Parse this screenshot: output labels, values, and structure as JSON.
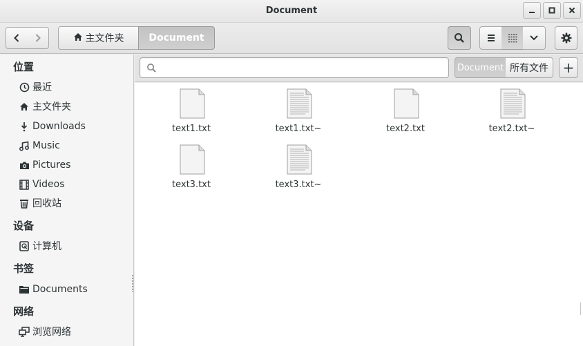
{
  "window": {
    "title": "Document"
  },
  "toolbar": {
    "path_home": "主文件夹",
    "path_current": "Document"
  },
  "sidebar": {
    "places_title": "位置",
    "places": [
      {
        "label": "最近",
        "icon": "clock-icon"
      },
      {
        "label": "主文件夹",
        "icon": "home-icon"
      },
      {
        "label": "Downloads",
        "icon": "download-icon"
      },
      {
        "label": "Music",
        "icon": "music-icon"
      },
      {
        "label": "Pictures",
        "icon": "camera-icon"
      },
      {
        "label": "Videos",
        "icon": "film-icon"
      },
      {
        "label": "回收站",
        "icon": "trash-icon"
      }
    ],
    "devices_title": "设备",
    "devices": [
      {
        "label": "计算机",
        "icon": "drive-icon"
      }
    ],
    "bookmarks_title": "书签",
    "bookmarks": [
      {
        "label": "Documents",
        "icon": "folder-icon"
      }
    ],
    "network_title": "网络",
    "network": [
      {
        "label": "浏览网络",
        "icon": "network-icon"
      }
    ]
  },
  "search": {
    "placeholder": "",
    "scope_current": "Document",
    "scope_all": "所有文件",
    "add_label": "+"
  },
  "files": [
    {
      "name": "text1.txt",
      "icon": "empty-text-file-icon"
    },
    {
      "name": "text1.txt~",
      "icon": "text-file-icon"
    },
    {
      "name": "text2.txt",
      "icon": "empty-text-file-icon"
    },
    {
      "name": "text2.txt~",
      "icon": "text-file-icon"
    },
    {
      "name": "text3.txt",
      "icon": "empty-text-file-icon"
    },
    {
      "name": "text3.txt~",
      "icon": "text-file-icon"
    }
  ]
}
